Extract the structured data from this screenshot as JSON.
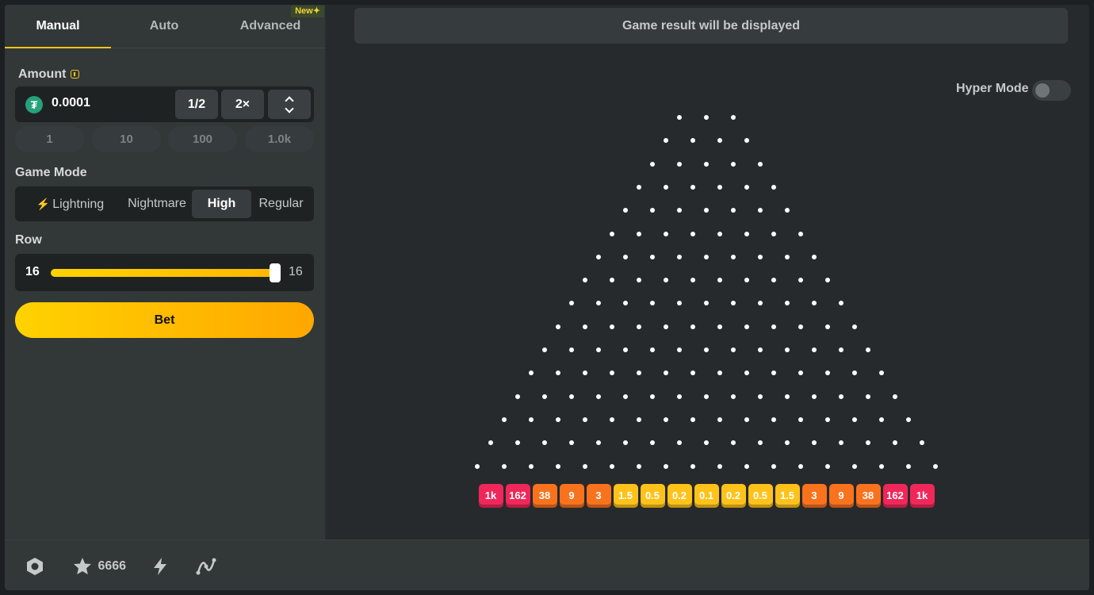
{
  "tabs": {
    "manual": "Manual",
    "auto": "Auto",
    "advanced": "Advanced",
    "new_badge": "New✦"
  },
  "amount": {
    "label": "Amount",
    "value": "0.0001",
    "currency_icon": "tether-icon",
    "half_label": "1/2",
    "double_label": "2×",
    "presets": [
      "1",
      "10",
      "100",
      "1.0k"
    ]
  },
  "game_mode": {
    "label": "Game Mode",
    "modes": [
      "Lightning",
      "Nightmare",
      "High",
      "Regular"
    ],
    "selected": "High"
  },
  "row": {
    "label": "Row",
    "value": "16",
    "max": "16",
    "level_fraction": 1.0
  },
  "bet_button": "Bet",
  "result_text": "Game result will be displayed",
  "hyper_mode": {
    "label": "Hyper Mode",
    "enabled": false
  },
  "board": {
    "peg_rows": 16,
    "buckets": [
      "1k",
      "162",
      "38",
      "9",
      "3",
      "1.5",
      "0.5",
      "0.2",
      "0.1",
      "0.2",
      "0.5",
      "1.5",
      "3",
      "9",
      "38",
      "162",
      "1k"
    ],
    "bucket_colors": [
      "#f0275a",
      "#f0275a",
      "#f9721e",
      "#f9721e",
      "#f9721e",
      "#ffc21a",
      "#ffc21a",
      "#ffc21a",
      "#ffc21a",
      "#ffc21a",
      "#ffc21a",
      "#ffc21a",
      "#f9721e",
      "#f9721e",
      "#f9721e",
      "#f0275a",
      "#f0275a"
    ]
  },
  "footer": {
    "favorites_count": "6666",
    "icons": [
      "settings-icon",
      "star-icon",
      "lightning-icon",
      "fairness-icon"
    ]
  },
  "colors": {
    "accent": "#ffc21a",
    "background": "#272a2c",
    "panel": "#323738"
  }
}
